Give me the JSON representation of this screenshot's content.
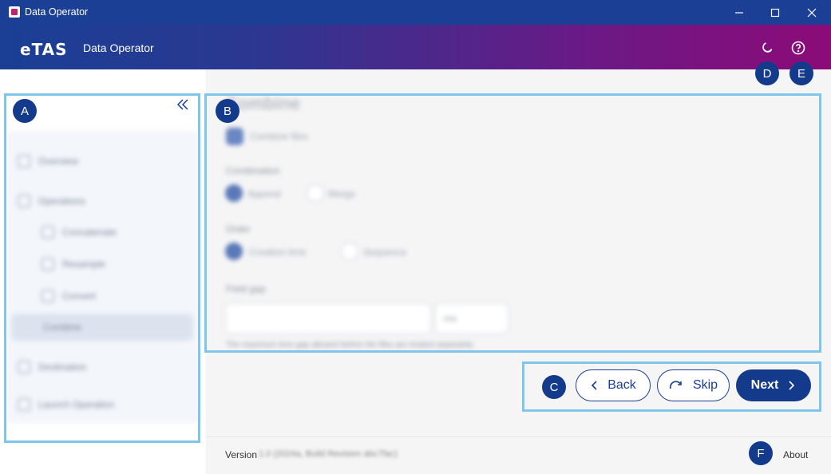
{
  "window": {
    "title": "Data Operator"
  },
  "header": {
    "logo_text": "eTAS",
    "app_title": "Data Operator"
  },
  "main": {
    "title": "Combine",
    "combine_files_label": "Combine files",
    "combination_label": "Combination",
    "combination_options": [
      "Append",
      "Merge"
    ],
    "order_label": "Order",
    "order_options": [
      "Creation time",
      "Sequence"
    ],
    "field_label": "Field gap",
    "field_unit": "ms",
    "field_hint": "The maximum time gap allowed before the files are treated separately"
  },
  "buttons": {
    "back": "Back",
    "skip": "Skip",
    "next": "Next"
  },
  "footer": {
    "version_label": "Version",
    "version_value": "1.0 (2024a, Build Revision abc7fac)",
    "about": "About"
  },
  "markers": {
    "a": "A",
    "b": "B",
    "c": "C",
    "d": "D",
    "e": "E",
    "f": "F"
  },
  "sidebar": {
    "items": [
      "Overview",
      "Operations",
      "Concatenate",
      "Resample",
      "Convert",
      "Combine",
      "Destination",
      "Launch Operation"
    ]
  }
}
